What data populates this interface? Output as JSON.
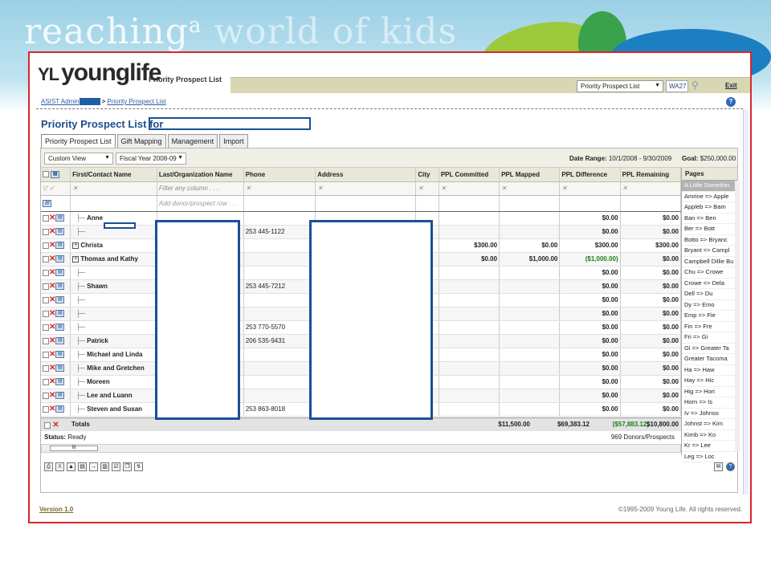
{
  "banner": {
    "tagline_main": "reaching",
    "tagline_small": "a",
    "tagline_ghost": "world of kids"
  },
  "header": {
    "logo_text": "younglife",
    "logo_mark": "YL",
    "product": "Priority Prospect List",
    "selector_value": "Priority Prospect List",
    "area_code": "WA27",
    "exit_label": "Exit"
  },
  "breadcrumb": {
    "home": "ASIST Admin",
    "separator": ">",
    "current": "Priority Prospect List"
  },
  "page": {
    "title": "Priority Prospect List for"
  },
  "tabs": [
    "Priority Prospect List",
    "Gift Mapping",
    "Management",
    "Import"
  ],
  "toolbar": {
    "view": "Custom View",
    "fiscal_year": "Fiscal Year 2008-09",
    "date_range_label": "Date Range:",
    "date_range_value": "10/1/2008 - 9/30/2009",
    "goal_label": "Goal:",
    "goal_value": "$250,000.00"
  },
  "columns": [
    "First/Contact Name",
    "Last/Organization Name",
    "Phone",
    "Address",
    "City",
    "PPL Committed",
    "PPL Mapped",
    "PPL Difference",
    "PPL Remaining"
  ],
  "filter_placeholder": "Filter any column . . .",
  "add_row_placeholder": "Add donor/prospect row . . .",
  "rows": [
    {
      "first": "Anne",
      "phone": "",
      "committed": "",
      "mapped": "",
      "difference": "$0.00",
      "remaining": "$0.00",
      "expand": false
    },
    {
      "first": "",
      "phone": "253 445-1122",
      "committed": "",
      "mapped": "",
      "difference": "$0.00",
      "remaining": "$0.00",
      "expand": false
    },
    {
      "first": "Christa",
      "phone": "",
      "committed": "$300.00",
      "mapped": "$0.00",
      "difference": "$300.00",
      "remaining": "$300.00",
      "expand": true
    },
    {
      "first": "Thomas and Kathy",
      "phone": "",
      "committed": "$0.00",
      "mapped": "$1,000.00",
      "difference": "($1,000.00)",
      "remaining": "$0.00",
      "expand": true
    },
    {
      "first": "",
      "phone": "",
      "committed": "",
      "mapped": "",
      "difference": "$0.00",
      "remaining": "$0.00",
      "expand": false
    },
    {
      "first": "Shawn",
      "phone": "253 445-7212",
      "committed": "",
      "mapped": "",
      "difference": "$0.00",
      "remaining": "$0.00",
      "expand": false
    },
    {
      "first": "",
      "phone": "",
      "committed": "",
      "mapped": "",
      "difference": "$0.00",
      "remaining": "$0.00",
      "expand": false
    },
    {
      "first": "",
      "phone": "",
      "committed": "",
      "mapped": "",
      "difference": "$0.00",
      "remaining": "$0.00",
      "expand": false
    },
    {
      "first": "",
      "phone": "253 770-5570",
      "committed": "",
      "mapped": "",
      "difference": "$0.00",
      "remaining": "$0.00",
      "expand": false
    },
    {
      "first": "Patrick",
      "phone": "206 535-9431",
      "committed": "",
      "mapped": "",
      "difference": "$0.00",
      "remaining": "$0.00",
      "expand": false
    },
    {
      "first": "Michael and Linda",
      "phone": "",
      "committed": "",
      "mapped": "",
      "difference": "$0.00",
      "remaining": "$0.00",
      "expand": false
    },
    {
      "first": "Mike and Gretchen",
      "phone": "",
      "committed": "",
      "mapped": "",
      "difference": "$0.00",
      "remaining": "$0.00",
      "expand": false
    },
    {
      "first": "Moreen",
      "phone": "",
      "committed": "",
      "mapped": "",
      "difference": "$0.00",
      "remaining": "$0.00",
      "expand": false
    },
    {
      "first": "Lee and Luann",
      "phone": "",
      "committed": "",
      "mapped": "",
      "difference": "$0.00",
      "remaining": "$0.00",
      "expand": false
    },
    {
      "first": "Steven and Susan",
      "phone": "253 863-8018",
      "committed": "",
      "mapped": "",
      "difference": "$0.00",
      "remaining": "$0.00",
      "expand": false
    }
  ],
  "totals": {
    "label": "Totals",
    "committed": "$11,500.00",
    "mapped": "$69,383.12",
    "difference": "($57,883.12)",
    "remaining": "$10,800.00"
  },
  "status": {
    "label": "Status:",
    "value": "Ready",
    "count": "969 Donors/Prospects"
  },
  "pages": {
    "title": "Pages",
    "items": [
      "A Little Somethin",
      "Amrine => Apple",
      "Appleb => Bam",
      "Ban => Ben",
      "Ber => Bott",
      "Botto => Bryanc",
      "Bryant => Campl",
      "Campbell Dillie Bu",
      "Chu => Crowe",
      "Crowe => Dela",
      "Dell => Du",
      "Dy => Emo",
      "Emp => Fie",
      "Fin => Fre",
      "Fri => Gi",
      "Gl => Greater Ta",
      "Greater Tacoma",
      "Ha => Haw",
      "Hay => Hic",
      "Hig => Hori",
      "Horn => Is",
      "Iv => Johnso",
      "Johnst => Kim",
      "Kimb => Ko",
      "Kr => Lee",
      "Leg => Loc"
    ]
  },
  "footer": {
    "version": "Version 1.0",
    "copyright": "©1995-2009 Young Life. All rights reserved."
  },
  "colors": {
    "accent_red": "#d9262b",
    "title_blue": "#1f4e8c",
    "olive": "#d9d7b2",
    "negative_green": "#1a7f1a"
  }
}
